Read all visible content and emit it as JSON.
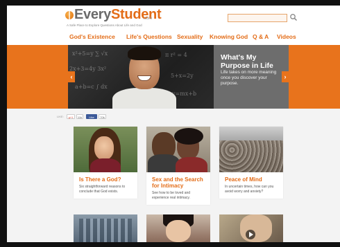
{
  "header": {
    "logo_prefix": "Every",
    "logo_highlight": "Student",
    "logo_suffix": ".com",
    "tagline": "A Safe Place to Explore Questions About Life and God",
    "search_placeholder": ""
  },
  "nav": {
    "items": [
      "God's Existence",
      "Life's Questions",
      "Sexuality",
      "Knowing God",
      "Q & A",
      "Videos"
    ]
  },
  "hero": {
    "title": "What's My Purpose in Life",
    "text": "Life takes on more meaning once you discover your purpose.",
    "prev_glyph": "‹",
    "next_glyph": "›"
  },
  "social": {
    "label": "LIKE:",
    "gplus_label": "g+1",
    "gplus_count": "11k",
    "fb_label": "Like",
    "fb_count": "70k"
  },
  "cards": [
    {
      "title": "Is There a God?",
      "desc": "Six straightforward reasons to conclude that God exists."
    },
    {
      "title": "Sex and the Search for Intimacy",
      "desc": "See how to be loved and experience real intimacy."
    },
    {
      "title": "Peace of Mind",
      "desc": "In uncertain times, how can you avoid worry and anxiety?"
    }
  ],
  "colors": {
    "accent": "#e36c17",
    "hero_bg": "#e8731c",
    "panel": "#6d6d6d"
  },
  "icons": {
    "search": "search-icon",
    "play": "play-icon"
  }
}
